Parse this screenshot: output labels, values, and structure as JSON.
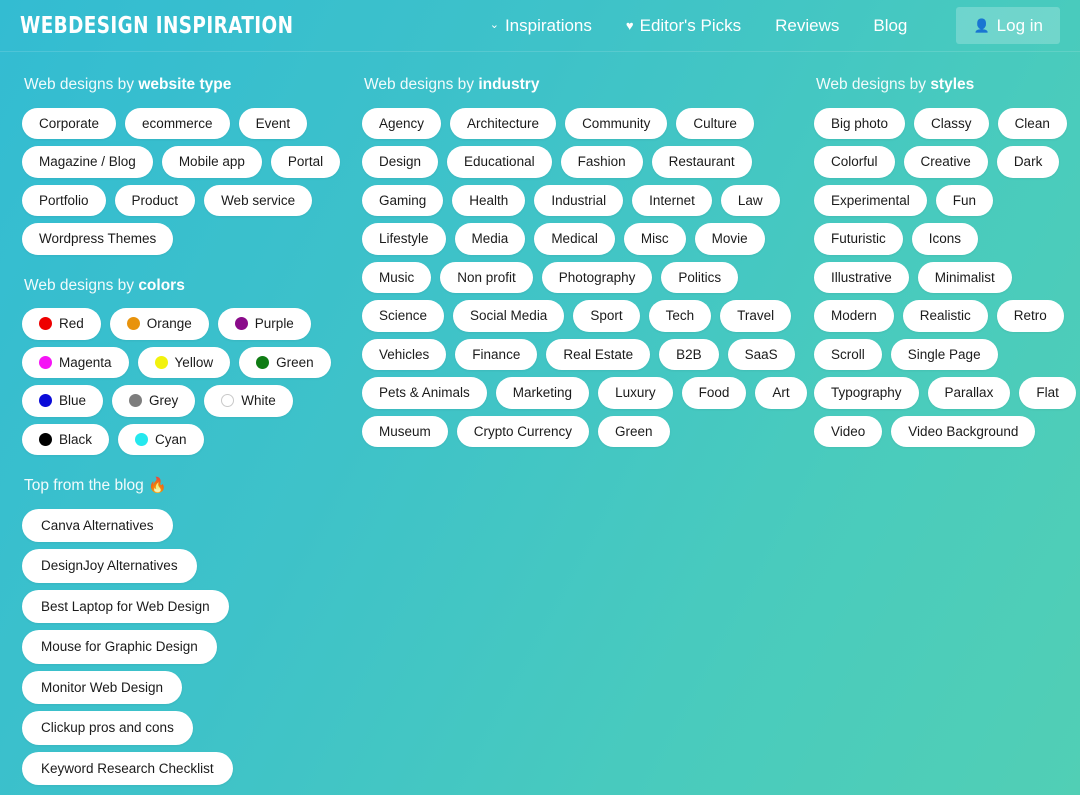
{
  "theme": {
    "bg_start": "#33bcd2",
    "bg_end": "#51cfb5",
    "chip_bg": "#ffffff",
    "chip_text": "#1b1b1b",
    "header_text": "#ffffff"
  },
  "header": {
    "logo": "WEBDESIGN INSPIRATION",
    "nav": [
      {
        "label": "Inspirations",
        "icon": "chevron-down-icon",
        "glyph": "⌄"
      },
      {
        "label": "Editor's Picks",
        "icon": "heart-icon",
        "glyph": "♥"
      },
      {
        "label": "Reviews",
        "icon": "",
        "glyph": ""
      },
      {
        "label": "Blog",
        "icon": "",
        "glyph": ""
      }
    ],
    "login": {
      "label": "Log in",
      "icon": "user-icon",
      "glyph": "👤"
    }
  },
  "sections": {
    "website_type": {
      "title_prefix": "Web designs by ",
      "title_strong": "website type",
      "items": [
        "Corporate",
        "ecommerce",
        "Event",
        "Magazine / Blog",
        "Mobile app",
        "Portal",
        "Portfolio",
        "Product",
        "Web service",
        "Wordpress Themes"
      ]
    },
    "colors": {
      "title_prefix": "Web designs by ",
      "title_strong": "colors",
      "items": [
        {
          "label": "Red",
          "color": "#ee0000"
        },
        {
          "label": "Orange",
          "color": "#e8930c"
        },
        {
          "label": "Purple",
          "color": "#8a0b8a"
        },
        {
          "label": "Magenta",
          "color": "#f514f5"
        },
        {
          "label": "Yellow",
          "color": "#f2f20d"
        },
        {
          "label": "Green",
          "color": "#0f7c14"
        },
        {
          "label": "Blue",
          "color": "#0b0bd8"
        },
        {
          "label": "Grey",
          "color": "#7d7d7d"
        },
        {
          "label": "White",
          "color": "#ffffff",
          "outline": true
        },
        {
          "label": "Black",
          "color": "#000000"
        },
        {
          "label": "Cyan",
          "color": "#25e8ee"
        }
      ]
    },
    "blog": {
      "title_prefix": "Top from the blog ",
      "title_strong": "",
      "emoji": "🔥",
      "items": [
        "Canva Alternatives",
        "DesignJoy Alternatives",
        "Best Laptop for Web Design",
        "Mouse for Graphic Design",
        "Monitor Web Design",
        "Clickup pros and cons",
        "Keyword Research Checklist"
      ]
    },
    "industry": {
      "title_prefix": "Web designs by ",
      "title_strong": "industry",
      "items": [
        "Agency",
        "Architecture",
        "Community",
        "Culture",
        "Design",
        "Educational",
        "Fashion",
        "Restaurant",
        "Gaming",
        "Health",
        "Industrial",
        "Internet",
        "Law",
        "Lifestyle",
        "Media",
        "Medical",
        "Misc",
        "Movie",
        "Music",
        "Non profit",
        "Photography",
        "Politics",
        "Science",
        "Social Media",
        "Sport",
        "Tech",
        "Travel",
        "Vehicles",
        "Finance",
        "Real Estate",
        "B2B",
        "SaaS",
        "Pets & Animals",
        "Marketing",
        "Luxury",
        "Food",
        "Art",
        "Museum",
        "Crypto Currency",
        "Green"
      ]
    },
    "styles": {
      "title_prefix": "Web designs by ",
      "title_strong": "styles",
      "items": [
        "Big photo",
        "Classy",
        "Clean",
        "Colorful",
        "Creative",
        "Dark",
        "Experimental",
        "Fun",
        "Futuristic",
        "Icons",
        "Illustrative",
        "Minimalist",
        "Modern",
        "Realistic",
        "Retro",
        "Scroll",
        "Single Page",
        "Typography",
        "Parallax",
        "Flat",
        "Video",
        "Video Background"
      ]
    }
  }
}
